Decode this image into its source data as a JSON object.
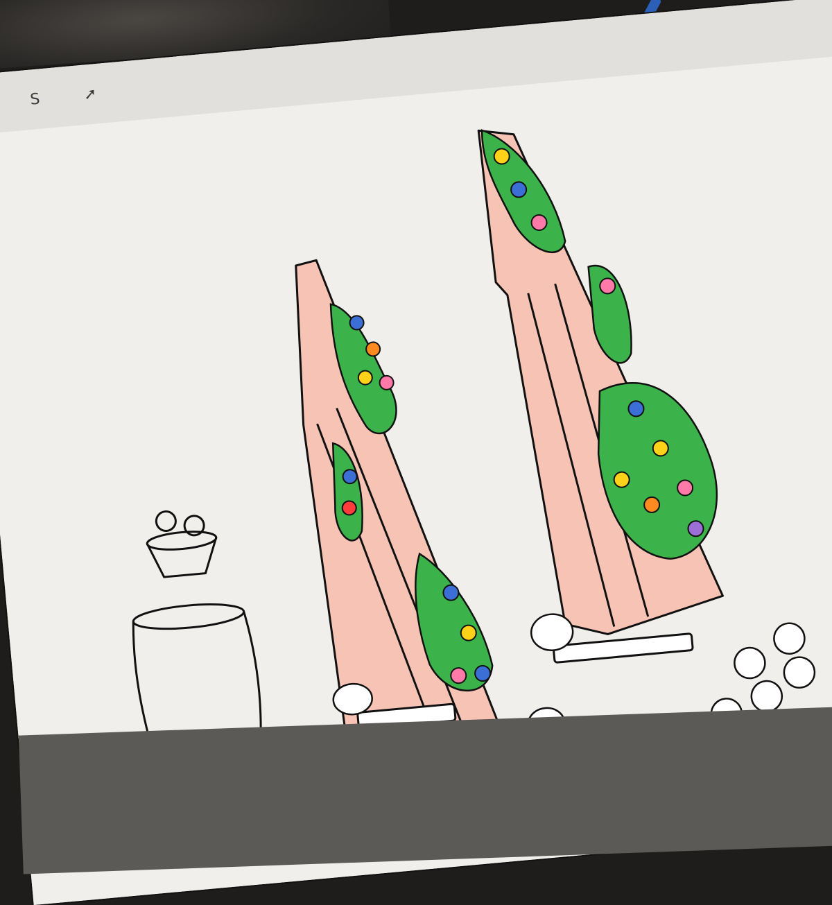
{
  "toolbar": {
    "tools": [
      {
        "name": "selection-tool",
        "glyph": "S"
      },
      {
        "name": "transform-tool",
        "glyph": "➚"
      }
    ]
  },
  "colors": {
    "tower_pink": "#f6c3b5",
    "leaf_green": "#3bb34a",
    "line_black": "#111111",
    "canvas": "#f1efeb",
    "flower_colors": [
      "#ff7aa8",
      "#3b6fd6",
      "#ff8a1f",
      "#ffd21a",
      "#ff3b3b",
      "#9b6fd6"
    ]
  }
}
